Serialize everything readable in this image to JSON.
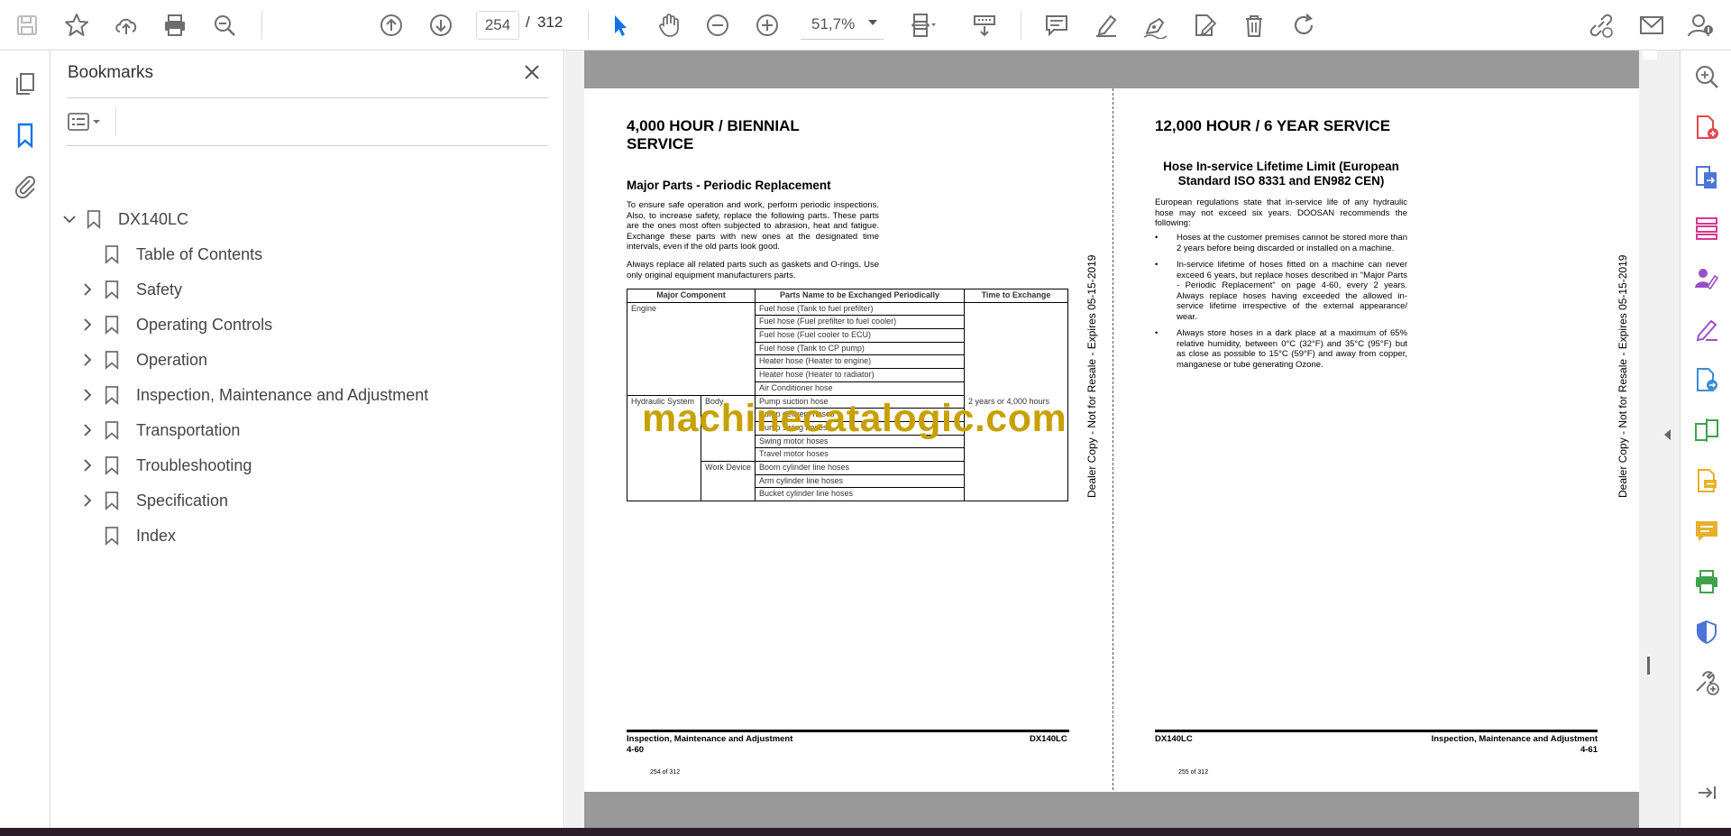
{
  "toolbar": {
    "current_page": "254",
    "page_separator": "/",
    "total_pages": "312",
    "zoom": "51,7%"
  },
  "bookmarks": {
    "title": "Bookmarks",
    "items": [
      {
        "label": "DX140LC",
        "expanded": true,
        "level": 0
      },
      {
        "label": "Table of Contents",
        "level": 1
      },
      {
        "label": "Safety",
        "level": 1
      },
      {
        "label": "Operating Controls",
        "level": 1
      },
      {
        "label": "Operation",
        "level": 1
      },
      {
        "label": "Inspection, Maintenance and Adjustment",
        "level": 1
      },
      {
        "label": "Transportation",
        "level": 1
      },
      {
        "label": "Troubleshooting",
        "level": 1
      },
      {
        "label": "Specification",
        "level": 1
      },
      {
        "label": "Index",
        "level": 1
      }
    ]
  },
  "left_page": {
    "heading_line1": "4,000 HOUR / BIENNIAL",
    "heading_line2": "SERVICE",
    "subheading": "Major Parts - Periodic Replacement",
    "para1": "To ensure safe operation and work, perform periodic inspections. Also, to increase safety, replace the following parts. These parts are the ones most often subjected to abrasion, heat and fatigue. Exchange these parts with new ones at the designated time intervals, even if the old parts look good.",
    "para2": "Always replace all related parts such as gaskets and O-rings. Use only original equipment manufacturers parts.",
    "table": {
      "headers": [
        "Major Component",
        "Parts Name to be Exchanged Periodically",
        "Time to Exchange"
      ],
      "engine_label": "Engine",
      "engine_parts": [
        "Fuel hose (Tank to fuel prefilter)",
        "Fuel hose (Fuel prefilter to fuel cooler)",
        "Fuel hose (Fuel cooler to ECU)",
        "Fuel hose (Tank to CP pump)",
        "Heater hose (Heater to engine)",
        "Heater hose (Heater to radiator)",
        "Air Conditioner hose"
      ],
      "hydraulic_label": "Hydraulic System",
      "body_label": "Body",
      "body_parts": [
        "Pump suction hose",
        "Pump delivery hoses",
        "Pump swing hoses",
        "Swing motor hoses",
        "Travel motor hoses"
      ],
      "work_label": "Work Device",
      "work_parts": [
        "Boom cylinder line hoses",
        "Arm cylinder line hoses",
        "Bucket cylinder line hoses"
      ],
      "time": "2 years or 4,000 hours"
    },
    "side_stamp": "Dealer Copy - Not for Resale - Expires 05-15-2019",
    "footer_left_title": "Inspection, Maintenance and Adjustment",
    "footer_left_page": "4-60",
    "footer_right": "DX140LC",
    "page_of": "254 of 312"
  },
  "right_page": {
    "heading": "12,000 HOUR / 6 YEAR SERVICE",
    "subheading_line1": "Hose In-service Lifetime Limit (European",
    "subheading_line2": "Standard ISO 8331 and EN982 CEN)",
    "intro": "European regulations state that in-service life of any hydraulic hose may not exceed six years. DOOSAN recommends the following:",
    "bullets": [
      "Hoses at the customer premises cannot be stored more than 2 years before being discarded or installed on a machine.",
      "In-service lifetime of hoses fitted on a machine can never exceed 6 years, but replace hoses described in \"Major Parts - Periodic Replacement\" on page 4-60, every 2 years. Always replace hoses having exceeded the allowed in-service lifetime irrespective of the external appearance/ wear.",
      "Always store hoses in a dark place at a maximum of 65% relative humidity, between 0°C (32°F) and 35°C (95°F) but as close as possible to 15°C (59°F) and away from copper, manganese or tube generating Ozone."
    ],
    "side_stamp": "Dealer Copy - Not for Resale - Expires 05-15-2019",
    "footer_left": "DX140LC",
    "footer_right_title": "Inspection, Maintenance and Adjustment",
    "footer_right_page": "4-61",
    "page_of": "255 of 312"
  },
  "watermark": "machinecatalogic.com",
  "colors": {
    "accent_blue": "#1473e6",
    "icon_gray": "#6e6e6e",
    "watermark": "#c8a000"
  }
}
